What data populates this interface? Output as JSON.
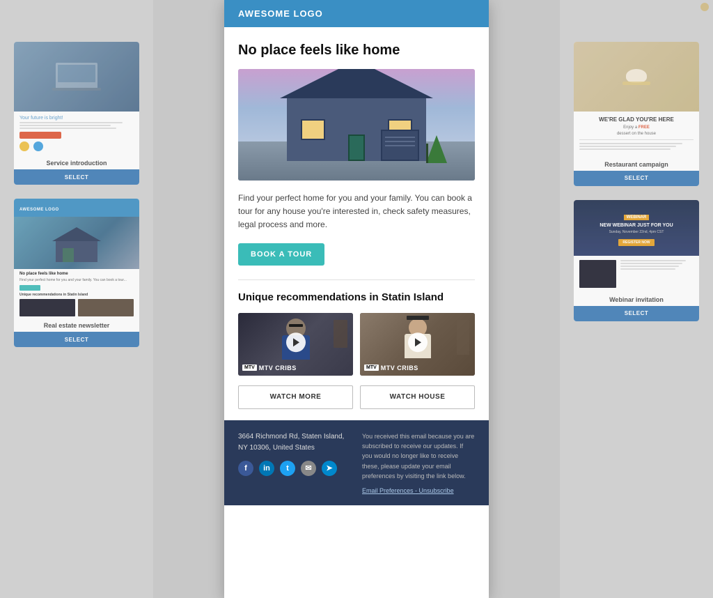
{
  "header": {
    "logo_text": "AWESOME LOGO"
  },
  "email": {
    "headline": "No place feels like home",
    "description": "Find your perfect home for you and your family. You can book a tour for any house you're interested in, check safety measures, legal process and more.",
    "book_tour_btn": "BOOK A TOUR",
    "recommendations_title": "Unique recommendations in Statin Island",
    "video1": {
      "badge": "MTV CRIBS",
      "watch_btn": "WATCH MORE"
    },
    "video2": {
      "badge": "MTV CRIBS",
      "watch_btn": "WATCH HOUSE"
    }
  },
  "footer": {
    "address": "3664 Richmond Rd, Staten Island, NY 10306, United States",
    "body_text": "You received this email because you are subscribed to receive our updates. If you would no longer like to receive these, please update your email preferences by visiting the link below.",
    "email_preferences": "Email Preferences",
    "unsubscribe": "Unsubscribe",
    "social_icons": [
      "facebook",
      "linkedin",
      "twitter",
      "email",
      "telegram"
    ]
  },
  "sidebar_left": {
    "card1_label": "Service introduction",
    "card1_select": "SELECT",
    "card2_label": "Real estate newsletter",
    "card2_select": "SELECT"
  },
  "sidebar_right": {
    "card1_label": "Restaurant campaign",
    "card1_select": "SELECT",
    "card2_label": "Webinar invitation",
    "card2_select": "SELECT",
    "restaurant_text": "WE'RE GLAD YOU'RE HERE",
    "restaurant_subtext": "Enjoy a FREE dessert on the house",
    "webinar_badge": "WEBINAR",
    "webinar_title": "NEW WEBINAR JUST FOR YOU",
    "webinar_date": "Sunday, November 22nd, 4pm CST"
  }
}
